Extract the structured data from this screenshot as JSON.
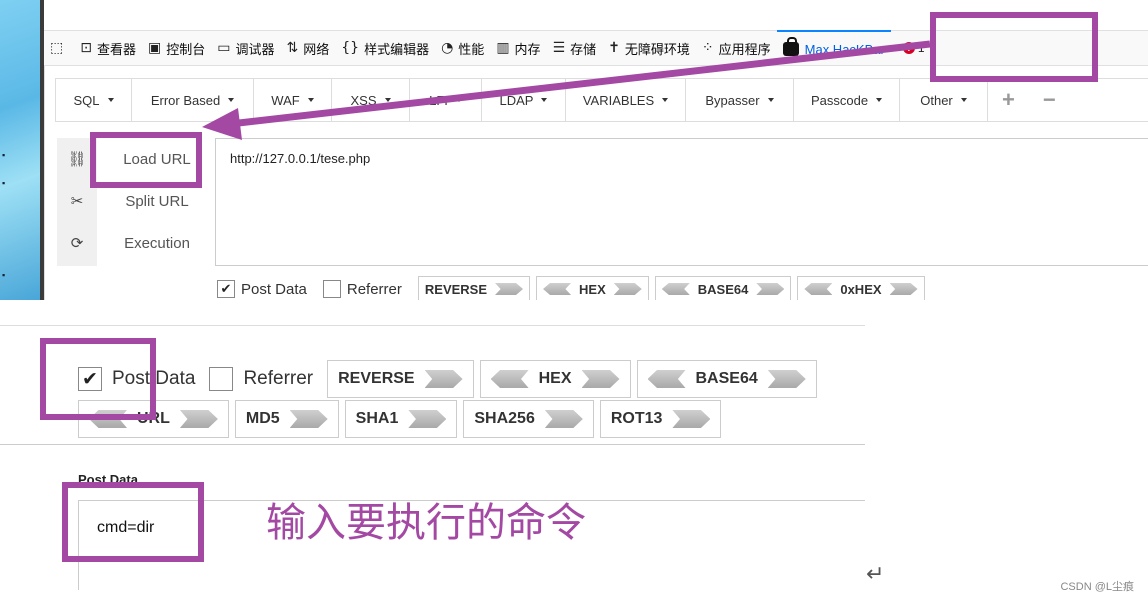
{
  "devtools": {
    "tabs": [
      {
        "label": "查看器",
        "icon": "inspector-icon"
      },
      {
        "label": "控制台",
        "icon": "console-icon"
      },
      {
        "label": "调试器",
        "icon": "debugger-icon"
      },
      {
        "label": "网络",
        "icon": "network-icon"
      },
      {
        "label": "样式编辑器",
        "icon": "style-editor-icon"
      },
      {
        "label": "性能",
        "icon": "performance-icon"
      },
      {
        "label": "内存",
        "icon": "memory-icon"
      },
      {
        "label": "存储",
        "icon": "storage-icon"
      },
      {
        "label": "无障碍环境",
        "icon": "accessibility-icon"
      },
      {
        "label": "应用程序",
        "icon": "application-icon"
      }
    ],
    "active_tab": "Max HacKBar",
    "error_count": "1"
  },
  "hackbar": {
    "menus": [
      "SQL",
      "Error Based",
      "WAF",
      "XSS",
      "LFI",
      "LDAP",
      "VARIABLES",
      "Bypasser",
      "Passcode",
      "Other"
    ],
    "actions": [
      "Load URL",
      "Split URL",
      "Execution"
    ],
    "url_value": "http://127.0.0.1/tese.php",
    "post_data_label": "Post Data",
    "referrer_label": "Referrer",
    "encoders_row1": [
      "REVERSE",
      "HEX",
      "BASE64",
      "0xHEX"
    ],
    "encoders_row2": [
      "URL",
      "MD5",
      "SHA1",
      "SHA256",
      "ROT13"
    ],
    "post_section_title": "Post Data",
    "post_value": "cmd=dir"
  },
  "annotation": {
    "text": "输入要执行的命令",
    "color": "#a349a4"
  },
  "watermark": "CSDN @L尘痕"
}
